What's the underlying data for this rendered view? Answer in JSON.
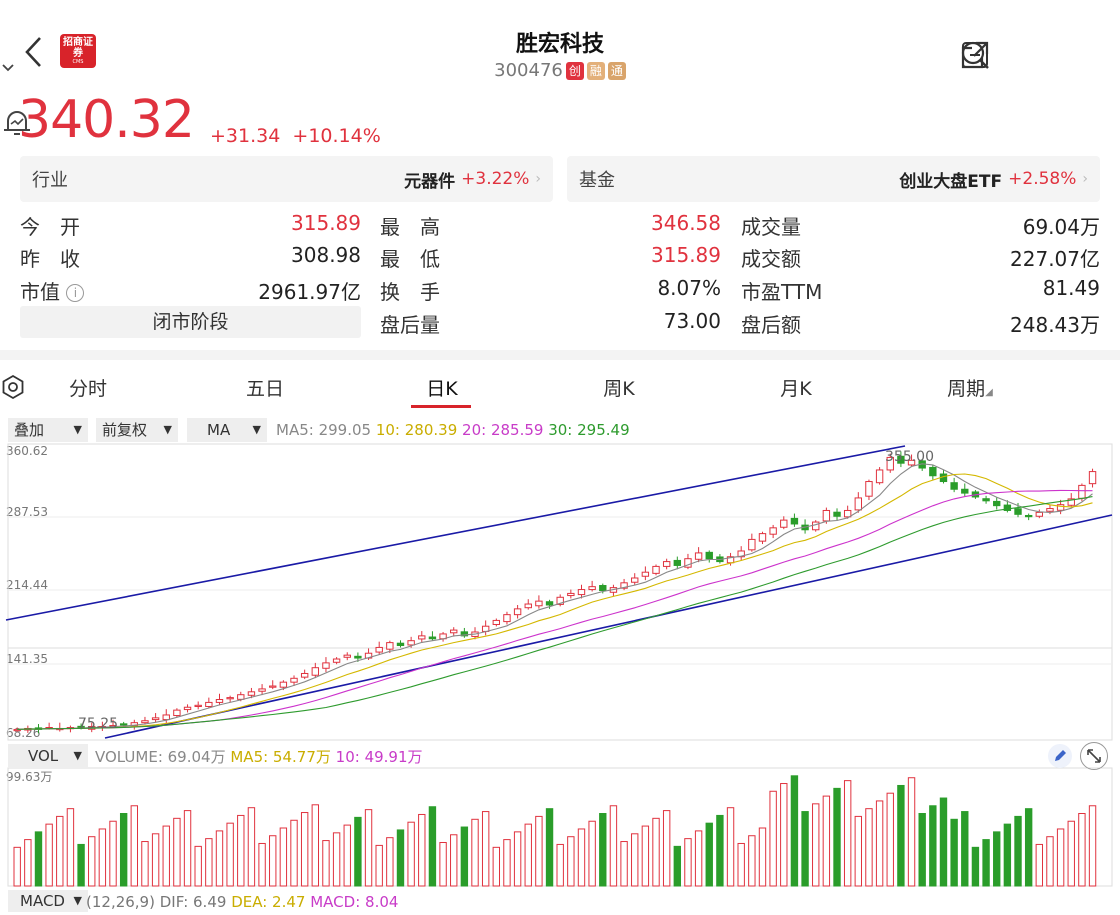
{
  "header": {
    "logo_text": "招商证券",
    "logo_sub": "CMS",
    "stock_name": "胜宏科技",
    "stock_code": "300476",
    "tags": [
      "创",
      "融",
      "通"
    ]
  },
  "quote": {
    "price": "340.32",
    "change": "+31.34",
    "change_pct": "+10.14%"
  },
  "industry": {
    "label": "行业",
    "name": "元器件",
    "pct": "+3.22%"
  },
  "fund": {
    "label": "基金",
    "name": "创业大盘ETF",
    "pct": "+2.58%"
  },
  "stats": {
    "open_k": "今　开",
    "open_v": "315.89",
    "prev_k": "昨　收",
    "prev_v": "308.98",
    "mcap_k": "市值",
    "mcap_v": "2961.97亿",
    "high_k": "最　高",
    "high_v": "346.58",
    "low_k": "最　低",
    "low_v": "315.89",
    "turn_k": "换　手",
    "turn_v": "8.07%",
    "ah_vol_k": "盘后量",
    "ah_vol_v": "73.00",
    "vol_k": "成交量",
    "vol_v": "69.04万",
    "amt_k": "成交额",
    "amt_v": "227.07亿",
    "pe_k": "市盈TTM",
    "pe_v": "81.49",
    "ah_amt_k": "盘后额",
    "ah_amt_v": "248.43万",
    "closed_label": "闭市阶段"
  },
  "tabs": [
    "分时",
    "五日",
    "日K",
    "周K",
    "月K",
    "周期"
  ],
  "active_tab": "日K",
  "toolbar": {
    "overlay": "叠加",
    "adjust": "前复权",
    "indicator": "MA",
    "ma5": "MA5: 299.05",
    "ma10": "10: 280.39",
    "ma20": "20: 285.59",
    "ma30": "30: 295.49"
  },
  "price_axis": [
    "360.62",
    "287.53",
    "214.44",
    "141.35",
    "68.26"
  ],
  "chart_annotations": {
    "high_mark": "355.00",
    "low_mark": "75.25"
  },
  "volume": {
    "label": "VOL",
    "value": "VOLUME: 69.04万",
    "ma5": "MA5: 54.77万",
    "ma10": "10: 49.91万",
    "axis_max": "99.63万"
  },
  "macd": {
    "label": "MACD",
    "params": "(12,26,9)",
    "dif": "DIF: 6.49",
    "dea": "DEA: 2.47",
    "macd": "MACD: 8.04"
  },
  "colors": {
    "up": "#e0323e",
    "down": "#2a9d2a",
    "ma5": "#888888",
    "ma10": "#d4b800",
    "ma20": "#cc33cc",
    "ma30": "#2e9b2e",
    "trend": "#1a1aa6"
  },
  "chart_data": {
    "type": "candlestick",
    "ylim": [
      68.26,
      360.62
    ],
    "closes": [
      73,
      74,
      73,
      75,
      74,
      75,
      75,
      76,
      76,
      77,
      78,
      80,
      82,
      85,
      88,
      93,
      96,
      98,
      101,
      104,
      106,
      109,
      112,
      115,
      118,
      122,
      126,
      131,
      137,
      142,
      146,
      150,
      147,
      152,
      158,
      163,
      160,
      165,
      170,
      167,
      172,
      176,
      170,
      174,
      180,
      186,
      192,
      198,
      203,
      206,
      202,
      210,
      214,
      218,
      221,
      217,
      220,
      225,
      230,
      236,
      242,
      247,
      243,
      250,
      256,
      250,
      247,
      252,
      258,
      270,
      276,
      282,
      290,
      286,
      280,
      288,
      300,
      294,
      300,
      313,
      330,
      342,
      355,
      349,
      352,
      344,
      336,
      330,
      322,
      318,
      314,
      310,
      305,
      300,
      296,
      294,
      298,
      302,
      306,
      312,
      326,
      340.32
    ]
  }
}
